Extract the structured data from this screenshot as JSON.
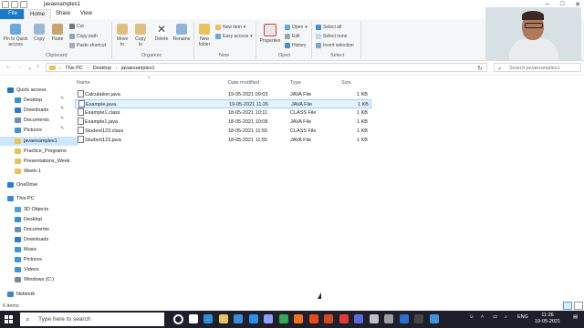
{
  "window": {
    "title": "javaexamples1",
    "controls": [
      "–",
      "□",
      "✕"
    ]
  },
  "tabs": {
    "file": "File",
    "home": "Home",
    "share": "Share",
    "view": "View"
  },
  "ribbon": {
    "pin": "Pin to Quick access",
    "copy": "Copy",
    "paste": "Paste",
    "cut": "Cut",
    "copy_path": "Copy path",
    "paste_shortcut": "Paste shortcut",
    "move_to": "Move to",
    "copy_to": "Copy to",
    "delete": "Delete",
    "rename": "Rename",
    "new_folder": "New folder",
    "new_item": "New item",
    "easy_access": "Easy access",
    "properties": "Properties",
    "open": "Open",
    "edit": "Edit",
    "history": "History",
    "select_all": "Select all",
    "select_none": "Select none",
    "invert_selection": "Invert selection",
    "groups": {
      "clipboard": "Clipboard",
      "organize": "Organize",
      "new": "New",
      "open": "Open",
      "select": "Select"
    }
  },
  "address": {
    "crumbs": [
      "This PC",
      "Desktop",
      "javaexamples1"
    ],
    "search_placeholder": "Search javaexamples1"
  },
  "sidebar": {
    "items": [
      {
        "label": "Quick access",
        "icon": "star-icon",
        "color": "#1979ca",
        "pinned": false,
        "indent": 0
      },
      {
        "label": "Desktop",
        "icon": "desktop-icon",
        "color": "#3b8fd9",
        "pinned": true,
        "indent": 1
      },
      {
        "label": "Downloads",
        "icon": "download-icon",
        "color": "#2a7fd0",
        "pinned": true,
        "indent": 1
      },
      {
        "label": "Documents",
        "icon": "document-icon",
        "color": "#6b8fb5",
        "pinned": true,
        "indent": 1
      },
      {
        "label": "Pictures",
        "icon": "pictures-icon",
        "color": "#3f95d8",
        "pinned": true,
        "indent": 1
      },
      {
        "label": "javaexamples1",
        "icon": "folder-icon",
        "color": "#e8c35a",
        "pinned": false,
        "indent": 1,
        "selected": true
      },
      {
        "label": "Practice_Programs",
        "icon": "folder-icon",
        "color": "#e8c35a",
        "pinned": false,
        "indent": 1
      },
      {
        "label": "Presentations_Week",
        "icon": "folder-icon",
        "color": "#e8c35a",
        "pinned": false,
        "indent": 1
      },
      {
        "label": "Week-1",
        "icon": "folder-icon",
        "color": "#e8c35a",
        "pinned": false,
        "indent": 1
      },
      {
        "label": "OneDrive",
        "icon": "cloud-icon",
        "color": "#1f7fd6",
        "pinned": false,
        "indent": 0
      },
      {
        "label": "This PC",
        "icon": "computer-icon",
        "color": "#3a8ad1",
        "pinned": false,
        "indent": 0
      },
      {
        "label": "3D Objects",
        "icon": "cube-icon",
        "color": "#4aa0e0",
        "pinned": false,
        "indent": 1
      },
      {
        "label": "Desktop",
        "icon": "desktop-icon",
        "color": "#3b8fd9",
        "pinned": false,
        "indent": 1
      },
      {
        "label": "Documents",
        "icon": "document-icon",
        "color": "#6b8fb5",
        "pinned": false,
        "indent": 1
      },
      {
        "label": "Downloads",
        "icon": "download-icon",
        "color": "#2a7fd0",
        "pinned": false,
        "indent": 1
      },
      {
        "label": "Music",
        "icon": "music-icon",
        "color": "#3f95d8",
        "pinned": false,
        "indent": 1
      },
      {
        "label": "Pictures",
        "icon": "pictures-icon",
        "color": "#3f95d8",
        "pinned": false,
        "indent": 1
      },
      {
        "label": "Videos",
        "icon": "video-icon",
        "color": "#3f95d8",
        "pinned": false,
        "indent": 1
      },
      {
        "label": "Windows (C:)",
        "icon": "drive-icon",
        "color": "#7b8a99",
        "pinned": false,
        "indent": 1
      },
      {
        "label": "Network",
        "icon": "network-icon",
        "color": "#3a8ad1",
        "pinned": false,
        "indent": 0
      }
    ]
  },
  "columns": [
    "Name",
    "Date modified",
    "Type",
    "Size"
  ],
  "files": [
    {
      "name": "Calculation.java",
      "date": "19-05-2021 09:03",
      "type": "JAVA File",
      "size": "1 KB"
    },
    {
      "name": "Example.java",
      "date": "19-05-2021 11:26",
      "type": "JAVA File",
      "size": "1 KB",
      "selected": true
    },
    {
      "name": "Example1.class",
      "date": "18-05-2021 10:11",
      "type": "CLASS File",
      "size": "1 KB"
    },
    {
      "name": "Example1.java",
      "date": "18-05-2021 10:08",
      "type": "JAVA File",
      "size": "1 KB"
    },
    {
      "name": "Student123.class",
      "date": "18-05-2021 11:55",
      "type": "CLASS File",
      "size": "1 KB"
    },
    {
      "name": "Student123.java",
      "date": "18-05-2021 11:55",
      "type": "JAVA File",
      "size": "1 KB"
    }
  ],
  "status": {
    "count": "6 items"
  },
  "taskbar": {
    "search_placeholder": "Type here to search",
    "apps": [
      {
        "icon": "cortana-icon",
        "color": "#ffffff"
      },
      {
        "icon": "task-view-icon",
        "color": "#ffffff"
      },
      {
        "icon": "edge-icon",
        "color": "#2f8fd8"
      },
      {
        "icon": "file-explorer-icon",
        "color": "#e8c35a"
      },
      {
        "icon": "store-icon",
        "color": "#3b8fd9"
      },
      {
        "icon": "dropbox-icon",
        "color": "#2a8ff0"
      },
      {
        "icon": "app-icon",
        "color": "#8fa0ff"
      },
      {
        "icon": "chrome-icon",
        "color": "#34a853"
      },
      {
        "icon": "firefox-icon",
        "color": "#f27121"
      },
      {
        "icon": "office-icon",
        "color": "#e64a19"
      },
      {
        "icon": "powerpoint-icon",
        "color": "#d24726"
      },
      {
        "icon": "acrobat-icon",
        "color": "#e53935"
      },
      {
        "icon": "media-icon",
        "color": "#5b6bd6"
      },
      {
        "icon": "settings-icon",
        "color": "#c0c0c0"
      },
      {
        "icon": "calculator-icon",
        "color": "#9e9e9e"
      },
      {
        "icon": "outlook-icon",
        "color": "#2a6fd0"
      },
      {
        "icon": "terminal-icon",
        "color": "#444444"
      },
      {
        "icon": "help-icon",
        "color": "#3f95d8"
      }
    ],
    "lang": "ENG",
    "time": "11:26",
    "date": "19-05-2021"
  }
}
